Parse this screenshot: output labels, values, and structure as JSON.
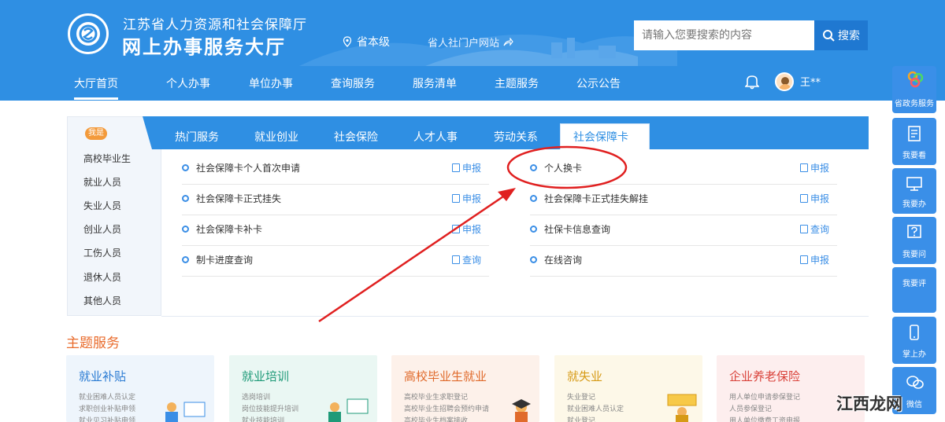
{
  "header": {
    "org_name": "江苏省人力资源和社会保障厅",
    "site_title": "网上办事服务大厅",
    "location": "省本级",
    "portal_link": "省人社门户网站",
    "search_placeholder": "请输入您要搜索的内容",
    "search_button": "搜索",
    "user_name": "王**"
  },
  "nav": {
    "items": [
      "大厅首页",
      "个人办事",
      "单位办事",
      "查询服务",
      "服务清单",
      "主题服务",
      "公示公告"
    ],
    "active": "大厅首页"
  },
  "categories": {
    "badge": "我是",
    "items": [
      "高校毕业生",
      "就业人员",
      "失业人员",
      "创业人员",
      "工伤人员",
      "退休人员",
      "其他人员"
    ]
  },
  "tabs": {
    "items": [
      "热门服务",
      "就业创业",
      "社会保险",
      "人才人事",
      "劳动关系",
      "社会保障卡"
    ],
    "active": "社会保障卡"
  },
  "services": {
    "left": [
      {
        "name": "社会保障卡个人首次申请",
        "action": "申报"
      },
      {
        "name": "社会保障卡正式挂失",
        "action": "申报"
      },
      {
        "name": "社会保障卡补卡",
        "action": "申报"
      },
      {
        "name": "制卡进度查询",
        "action": "查询"
      }
    ],
    "right": [
      {
        "name": "个人换卡",
        "action": "申报"
      },
      {
        "name": "社会保障卡正式挂失解挂",
        "action": "申报"
      },
      {
        "name": "社保卡信息查询",
        "action": "查询"
      },
      {
        "name": "在线咨询",
        "action": "申报"
      }
    ]
  },
  "theme": {
    "title": "主题服务",
    "cards": [
      {
        "title": "就业补贴",
        "lines": [
          "就业困难人员认定",
          "求职创业补贴申领",
          "就业见习补贴申领"
        ]
      },
      {
        "title": "就业培训",
        "lines": [
          "选岗培训",
          "岗位技能提升培训",
          "就业技能培训"
        ]
      },
      {
        "title": "高校毕业生就业",
        "lines": [
          "高校毕业生求职登记",
          "高校毕业生招聘会预约申请",
          "高校毕业生档案接收"
        ]
      },
      {
        "title": "就失业",
        "lines": [
          "失业登记",
          "就业困难人员认定",
          "就业登记"
        ]
      },
      {
        "title": "企业养老保险",
        "lines": [
          "用人单位申请参保登记",
          "人员参保登记",
          "用人单位缴费工资申报"
        ]
      }
    ]
  },
  "toolbar": {
    "items": [
      "省政务服务",
      "我要看",
      "我要办",
      "我要问",
      "我要评",
      "掌上办",
      "微信"
    ]
  },
  "watermark": {
    "text": "江西龙网"
  }
}
